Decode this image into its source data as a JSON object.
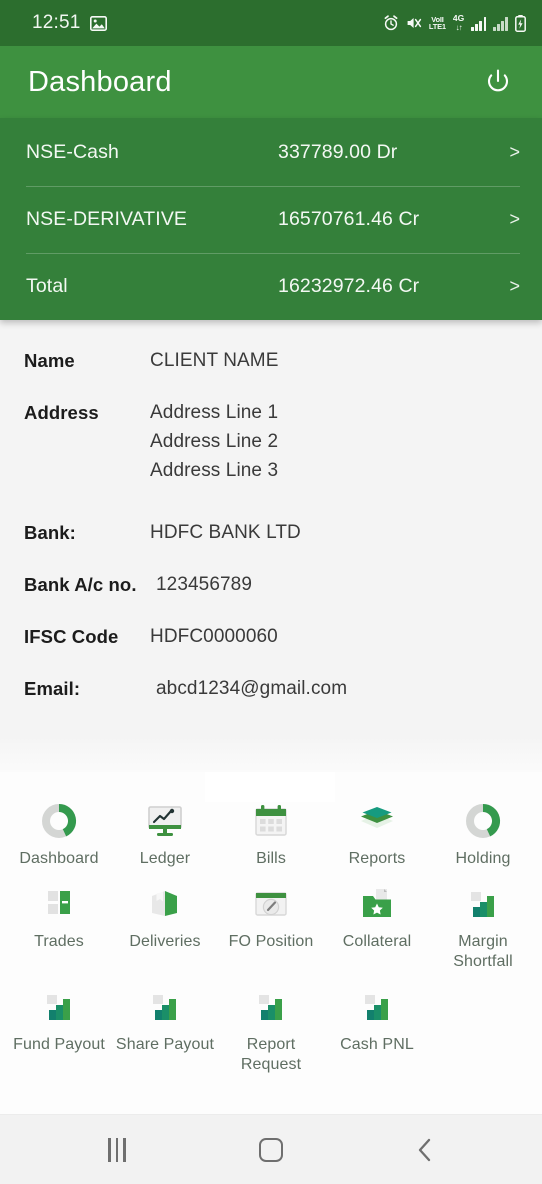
{
  "status_bar": {
    "time": "12:51",
    "icons_left": [
      "image-icon"
    ],
    "icons_right": [
      "alarm-icon",
      "mute-icon",
      "volte-icon",
      "network-4g-icon",
      "signal-bars-icon",
      "signal-bars-secondary-icon",
      "battery-charging-icon"
    ],
    "volte_label": "VoLTE1",
    "network_label": "4G",
    "background_color": "#2c6e2e"
  },
  "app_bar": {
    "title": "Dashboard",
    "power_icon": "power-icon",
    "background_color": "#3e9140"
  },
  "balances": {
    "background_color": "#34803a",
    "chevron": ">",
    "rows": [
      {
        "segment": "NSE-Cash",
        "amount": "337789.00 Dr"
      },
      {
        "segment": "NSE-DERIVATIVE",
        "amount": "16570761.46 Cr"
      },
      {
        "segment": "Total",
        "amount": "16232972.46 Cr"
      }
    ]
  },
  "details": {
    "name_label": "Name",
    "name_value": "CLIENT NAME",
    "address_label": "Address",
    "address_lines": [
      "Address Line 1",
      "Address Line 2",
      "Address Line 3"
    ],
    "bank_label": "Bank:",
    "bank_value": "HDFC BANK LTD",
    "account_label": "Bank A/c no.",
    "account_value": "123456789",
    "ifsc_label": "IFSC Code",
    "ifsc_value": "HDFC0000060",
    "email_label": "Email:",
    "email_value": "abcd1234@gmail.com"
  },
  "menu": {
    "label_color": "#5f6e62",
    "accent_color": "#3e9140",
    "rows": [
      [
        {
          "label": "Dashboard",
          "icon": "donut-chart-icon"
        },
        {
          "label": "Ledger",
          "icon": "monitor-line-chart-icon"
        },
        {
          "label": "Bills",
          "icon": "calendar-icon"
        },
        {
          "label": "Reports",
          "icon": "layers-icon"
        },
        {
          "label": "Holding",
          "icon": "donut-chart-icon"
        }
      ],
      [
        {
          "label": "Trades",
          "icon": "columns-icon"
        },
        {
          "label": "Deliveries",
          "icon": "box-icon"
        },
        {
          "label": "FO Position",
          "icon": "gauge-window-icon"
        },
        {
          "label": "Collateral",
          "icon": "folder-star-icon"
        },
        {
          "label": "Margin Shortfall",
          "icon": "bar-chart-icon"
        }
      ],
      [
        {
          "label": "Fund Payout",
          "icon": "bar-chart-icon"
        },
        {
          "label": "Share Payout",
          "icon": "bar-chart-icon"
        },
        {
          "label": "Report Request",
          "icon": "bar-chart-icon"
        },
        {
          "label": "Cash PNL",
          "icon": "bar-chart-icon"
        }
      ]
    ]
  },
  "nav_bar": {
    "recents_icon": "recents-icon",
    "home_icon": "home-icon",
    "back_icon": "back-chevron-icon"
  }
}
